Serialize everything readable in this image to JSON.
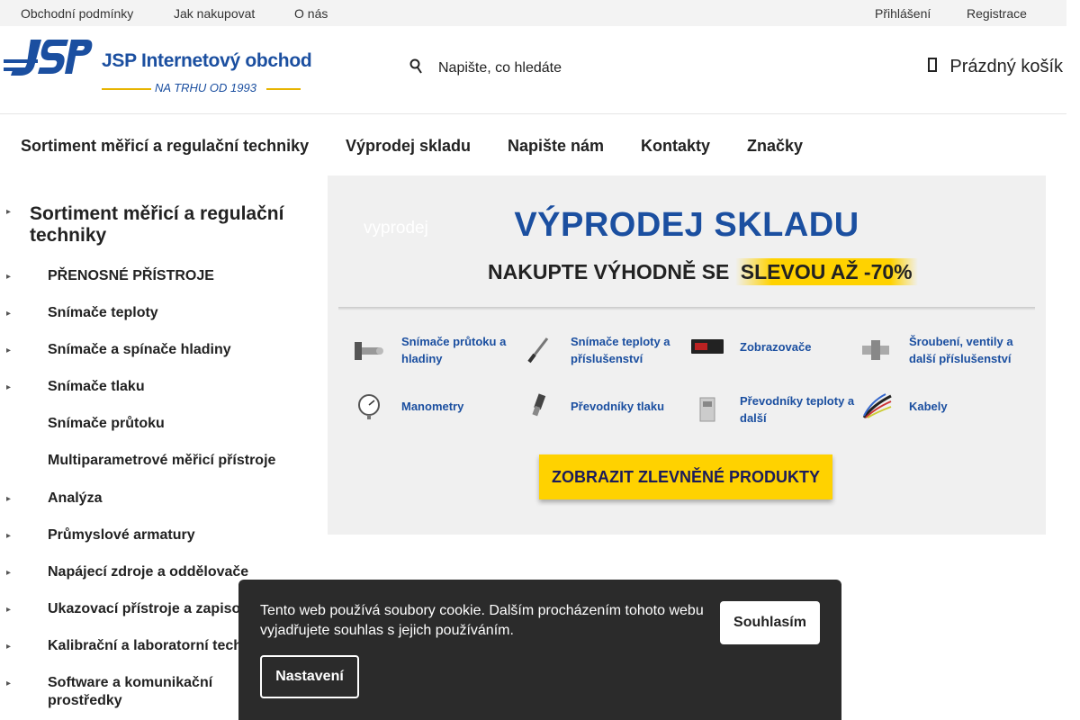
{
  "topbar": {
    "links": [
      "Obchodní podmínky",
      "Jak nakupovat",
      "O nás"
    ],
    "login": "Přihlášení",
    "register": "Registrace"
  },
  "header": {
    "logo_title": "JSP Internetový obchod",
    "logo_subtitle": "NA TRHU OD 1993",
    "search_placeholder": "Napište, co hledáte",
    "search_icon": "search-icon",
    "cart_label": "Prázdný košík",
    "cart_icon": "cart-icon"
  },
  "mainnav": [
    "Sortiment měřicí a regulační techniky",
    "Výprodej skladu",
    "Napište nám",
    "Kontakty",
    "Značky"
  ],
  "sidebar": {
    "heading": "Sortiment měřicí a regulační techniky",
    "items": [
      {
        "label": "PŘENOSNÉ PŘÍSTROJE",
        "arrow": true
      },
      {
        "label": "Snímače teploty",
        "arrow": true
      },
      {
        "label": "Snímače a spínače hladiny",
        "arrow": true
      },
      {
        "label": "Snímače tlaku",
        "arrow": true
      },
      {
        "label": "Snímače průtoku",
        "arrow": false
      },
      {
        "label": "Multiparametrové měřicí přístroje",
        "arrow": false
      },
      {
        "label": "Analýza",
        "arrow": true
      },
      {
        "label": "Průmyslové armatury",
        "arrow": true
      },
      {
        "label": "Napájecí zdroje a oddělovače",
        "arrow": true
      },
      {
        "label": "Ukazovací přístroje a zapisovače",
        "arrow": true
      },
      {
        "label": "Kalibrační a laboratorní technika",
        "arrow": true
      },
      {
        "label": "Software a komunikační prostředky",
        "arrow": true
      }
    ]
  },
  "banner": {
    "alt_text": "vyprodej",
    "title": "VÝPRODEJ SKLADU",
    "subtitle_prefix": "NAKUPTE VÝHODNĚ SE ",
    "subtitle_highlight": "SLEVOU AŽ -70%",
    "categories": [
      "Snímače průtoku a hladiny",
      "Snímače teploty a příslušenství",
      "Zobrazovače",
      "Šroubení, ventily a další příslušenství",
      "Manometry",
      "Převodníky tlaku",
      "Převodníky teploty a další",
      "Kabely"
    ],
    "button": "ZOBRAZIT ZLEVNĚNÉ PRODUKTY"
  },
  "cookie": {
    "text": "Tento web používá soubory cookie. Dalším procházením tohoto webu vyjadřujete souhlas s jejich používáním.",
    "accept": "Souhlasím",
    "settings": "Nastavení"
  },
  "colors": {
    "brand_blue": "#1b4fa0",
    "accent_yellow": "#ffd200",
    "cookie_bg": "#2b2b2b"
  }
}
